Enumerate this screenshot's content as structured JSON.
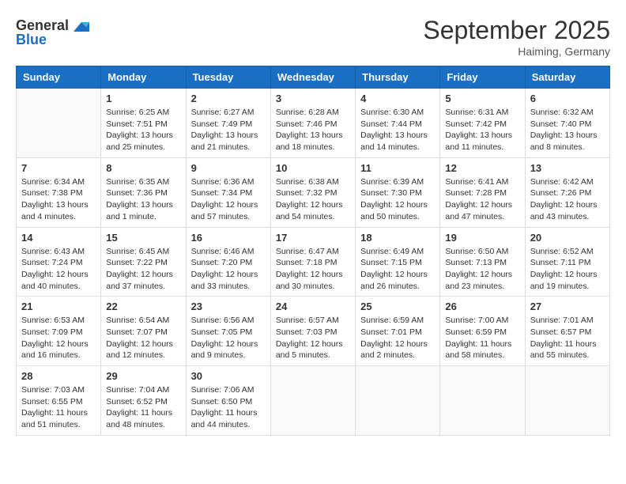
{
  "logo": {
    "general": "General",
    "blue": "Blue"
  },
  "title": "September 2025",
  "location": "Haiming, Germany",
  "days_of_week": [
    "Sunday",
    "Monday",
    "Tuesday",
    "Wednesday",
    "Thursday",
    "Friday",
    "Saturday"
  ],
  "weeks": [
    [
      {
        "day": "",
        "info": ""
      },
      {
        "day": "1",
        "info": "Sunrise: 6:25 AM\nSunset: 7:51 PM\nDaylight: 13 hours and 25 minutes."
      },
      {
        "day": "2",
        "info": "Sunrise: 6:27 AM\nSunset: 7:49 PM\nDaylight: 13 hours and 21 minutes."
      },
      {
        "day": "3",
        "info": "Sunrise: 6:28 AM\nSunset: 7:46 PM\nDaylight: 13 hours and 18 minutes."
      },
      {
        "day": "4",
        "info": "Sunrise: 6:30 AM\nSunset: 7:44 PM\nDaylight: 13 hours and 14 minutes."
      },
      {
        "day": "5",
        "info": "Sunrise: 6:31 AM\nSunset: 7:42 PM\nDaylight: 13 hours and 11 minutes."
      },
      {
        "day": "6",
        "info": "Sunrise: 6:32 AM\nSunset: 7:40 PM\nDaylight: 13 hours and 8 minutes."
      }
    ],
    [
      {
        "day": "7",
        "info": "Sunrise: 6:34 AM\nSunset: 7:38 PM\nDaylight: 13 hours and 4 minutes."
      },
      {
        "day": "8",
        "info": "Sunrise: 6:35 AM\nSunset: 7:36 PM\nDaylight: 13 hours and 1 minute."
      },
      {
        "day": "9",
        "info": "Sunrise: 6:36 AM\nSunset: 7:34 PM\nDaylight: 12 hours and 57 minutes."
      },
      {
        "day": "10",
        "info": "Sunrise: 6:38 AM\nSunset: 7:32 PM\nDaylight: 12 hours and 54 minutes."
      },
      {
        "day": "11",
        "info": "Sunrise: 6:39 AM\nSunset: 7:30 PM\nDaylight: 12 hours and 50 minutes."
      },
      {
        "day": "12",
        "info": "Sunrise: 6:41 AM\nSunset: 7:28 PM\nDaylight: 12 hours and 47 minutes."
      },
      {
        "day": "13",
        "info": "Sunrise: 6:42 AM\nSunset: 7:26 PM\nDaylight: 12 hours and 43 minutes."
      }
    ],
    [
      {
        "day": "14",
        "info": "Sunrise: 6:43 AM\nSunset: 7:24 PM\nDaylight: 12 hours and 40 minutes."
      },
      {
        "day": "15",
        "info": "Sunrise: 6:45 AM\nSunset: 7:22 PM\nDaylight: 12 hours and 37 minutes."
      },
      {
        "day": "16",
        "info": "Sunrise: 6:46 AM\nSunset: 7:20 PM\nDaylight: 12 hours and 33 minutes."
      },
      {
        "day": "17",
        "info": "Sunrise: 6:47 AM\nSunset: 7:18 PM\nDaylight: 12 hours and 30 minutes."
      },
      {
        "day": "18",
        "info": "Sunrise: 6:49 AM\nSunset: 7:15 PM\nDaylight: 12 hours and 26 minutes."
      },
      {
        "day": "19",
        "info": "Sunrise: 6:50 AM\nSunset: 7:13 PM\nDaylight: 12 hours and 23 minutes."
      },
      {
        "day": "20",
        "info": "Sunrise: 6:52 AM\nSunset: 7:11 PM\nDaylight: 12 hours and 19 minutes."
      }
    ],
    [
      {
        "day": "21",
        "info": "Sunrise: 6:53 AM\nSunset: 7:09 PM\nDaylight: 12 hours and 16 minutes."
      },
      {
        "day": "22",
        "info": "Sunrise: 6:54 AM\nSunset: 7:07 PM\nDaylight: 12 hours and 12 minutes."
      },
      {
        "day": "23",
        "info": "Sunrise: 6:56 AM\nSunset: 7:05 PM\nDaylight: 12 hours and 9 minutes."
      },
      {
        "day": "24",
        "info": "Sunrise: 6:57 AM\nSunset: 7:03 PM\nDaylight: 12 hours and 5 minutes."
      },
      {
        "day": "25",
        "info": "Sunrise: 6:59 AM\nSunset: 7:01 PM\nDaylight: 12 hours and 2 minutes."
      },
      {
        "day": "26",
        "info": "Sunrise: 7:00 AM\nSunset: 6:59 PM\nDaylight: 11 hours and 58 minutes."
      },
      {
        "day": "27",
        "info": "Sunrise: 7:01 AM\nSunset: 6:57 PM\nDaylight: 11 hours and 55 minutes."
      }
    ],
    [
      {
        "day": "28",
        "info": "Sunrise: 7:03 AM\nSunset: 6:55 PM\nDaylight: 11 hours and 51 minutes."
      },
      {
        "day": "29",
        "info": "Sunrise: 7:04 AM\nSunset: 6:52 PM\nDaylight: 11 hours and 48 minutes."
      },
      {
        "day": "30",
        "info": "Sunrise: 7:06 AM\nSunset: 6:50 PM\nDaylight: 11 hours and 44 minutes."
      },
      {
        "day": "",
        "info": ""
      },
      {
        "day": "",
        "info": ""
      },
      {
        "day": "",
        "info": ""
      },
      {
        "day": "",
        "info": ""
      }
    ]
  ]
}
